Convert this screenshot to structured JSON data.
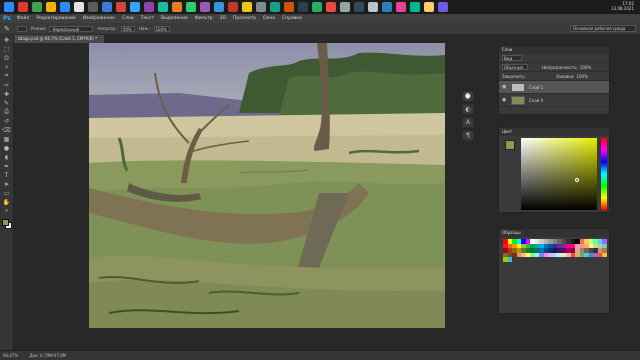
{
  "taskbar": {
    "icons": [
      "#2e8bff",
      "#e03a2e",
      "#3fa34d",
      "#f0b400",
      "#2e8bff",
      "#e2e2e2",
      "#5c5c5c",
      "#3a7bd5",
      "#d64541",
      "#31a8ff",
      "#8e44ad",
      "#1abc9c",
      "#e67e22",
      "#2ecc71",
      "#9b59b6",
      "#3498db",
      "#c0392b",
      "#f1c40f",
      "#7f8c8d",
      "#16a085",
      "#d35400",
      "#2c3e50",
      "#27ae60",
      "#e74c3c",
      "#95a5a6",
      "#34495e",
      "#bdc3c7",
      "#2980b9",
      "#e84393",
      "#00b894",
      "#fdcb6e",
      "#6c5ce7"
    ],
    "clock_time": "17:02",
    "clock_date": "13.08.2021"
  },
  "menubar": {
    "logo": "Ps",
    "items": [
      "Файл",
      "Редактирование",
      "Изображение",
      "Слои",
      "Текст",
      "Выделение",
      "Фильтр",
      "3D",
      "Просмотр",
      "Окно",
      "Справка"
    ]
  },
  "options": {
    "mode_label": "Режим:",
    "mode_value": "Нормальный",
    "opacity_label": "Непрозр.:",
    "opacity_value": "50%",
    "flow_label": "Наж.:",
    "flow_value": "100%",
    "workspace": "Основная рабочая среда"
  },
  "document": {
    "tab_title": "Шарр.psd @ 66,7% (Слой 1, CMYK/8) *",
    "zoom": "66,67%",
    "doc_info": "Док: 8,79М/47,8М"
  },
  "layers_panel": {
    "title": "Слои",
    "kind_label": "Вид",
    "blend_mode": "Обычные",
    "opacity_label": "Непрозрачность:",
    "opacity_value": "100%",
    "lock_label": "Закрепить:",
    "fill_label": "Заливка:",
    "fill_value": "100%",
    "layers": [
      {
        "name": "Слой 1",
        "visible": true,
        "selected": true
      },
      {
        "name": "Слой 0",
        "visible": true,
        "selected": false
      }
    ]
  },
  "color_panel": {
    "title": "Цвет",
    "foreground": "#8a9a52",
    "background": "#ffffff",
    "field_hue": "#e5ef00"
  },
  "swatches_panel": {
    "title": "Образцы",
    "colors": [
      "#ff0000",
      "#ffff00",
      "#00ff00",
      "#00ffff",
      "#0000ff",
      "#ff00ff",
      "#ffffff",
      "#e6e6e6",
      "#cccccc",
      "#b3b3b3",
      "#999999",
      "#808080",
      "#666666",
      "#4d4d4d",
      "#333333",
      "#1a1a1a",
      "#000000",
      "#ff6666",
      "#ffcc66",
      "#ccff66",
      "#66ff99",
      "#66ccff",
      "#9966ff",
      "#ed1c24",
      "#f26522",
      "#f7941d",
      "#fff200",
      "#8dc63f",
      "#39b54a",
      "#00a651",
      "#00a99d",
      "#00aeef",
      "#0072bc",
      "#0054a6",
      "#2e3192",
      "#662d91",
      "#92278f",
      "#ec008c",
      "#ed145b",
      "#f49ac1",
      "#f7977a",
      "#fbaf5d",
      "#fff799",
      "#c4df9b",
      "#a3d39c",
      "#82ca9c",
      "#9e0b0f",
      "#a0410d",
      "#a36209",
      "#aba000",
      "#598527",
      "#1a7b30",
      "#007236",
      "#00746b",
      "#0076a3",
      "#004b80",
      "#003471",
      "#1b1464",
      "#440e62",
      "#630460",
      "#9e005d",
      "#9e0039",
      "#c7b299",
      "#998675",
      "#736357",
      "#534741",
      "#37302d",
      "#c69c6d",
      "#a67c52",
      "#8c6239",
      "#754c24",
      "#603913",
      "#ff7f7f",
      "#ffbf7f",
      "#ffff7f",
      "#7fff7f",
      "#7fffff",
      "#7f7fff",
      "#ff7fff",
      "#e0b0ff",
      "#b0e0ff",
      "#b0ffe0",
      "#ffe0b0",
      "#ffb0b0",
      "#d9534f",
      "#f0ad4e",
      "#5cb85c",
      "#5bc0de",
      "#428bca",
      "#aa66cc",
      "#ff4444",
      "#ffbb33",
      "#99cc00",
      "#33b5e5"
    ]
  },
  "toolbox": {
    "tools": [
      "move-tool",
      "marquee-tool",
      "lasso-tool",
      "quick-select-tool",
      "crop-tool",
      "eyedropper-tool",
      "healing-tool",
      "brush-tool",
      "clone-stamp-tool",
      "history-brush-tool",
      "eraser-tool",
      "gradient-tool",
      "blur-tool",
      "dodge-tool",
      "pen-tool",
      "type-tool",
      "path-select-tool",
      "shape-tool",
      "hand-tool",
      "zoom-tool"
    ]
  }
}
